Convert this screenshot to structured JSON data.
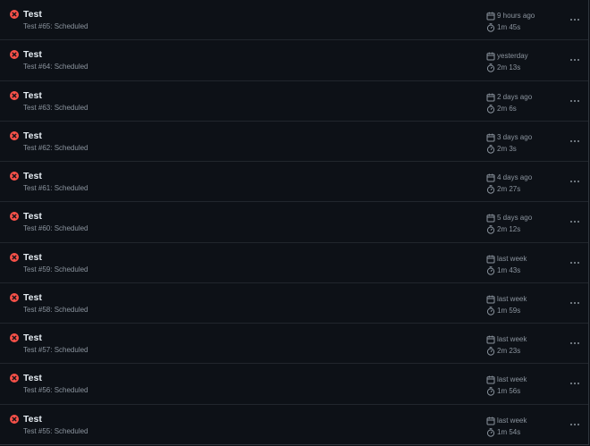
{
  "colors": {
    "background": "#0d1117",
    "failure": "#f85149",
    "text_primary": "#e6edf3",
    "text_muted": "#8b949e",
    "divider": "#21262d"
  },
  "icons": {
    "status": "x-circle-icon",
    "date": "calendar-icon",
    "duration": "stopwatch-icon",
    "menu": "kebab-horizontal-icon"
  },
  "runs": [
    {
      "title": "Test",
      "subtitle": "Test #65: Scheduled",
      "time": "9 hours ago",
      "duration": "1m 45s",
      "status": "failure"
    },
    {
      "title": "Test",
      "subtitle": "Test #64: Scheduled",
      "time": "yesterday",
      "duration": "2m 13s",
      "status": "failure"
    },
    {
      "title": "Test",
      "subtitle": "Test #63: Scheduled",
      "time": "2 days ago",
      "duration": "2m 6s",
      "status": "failure"
    },
    {
      "title": "Test",
      "subtitle": "Test #62: Scheduled",
      "time": "3 days ago",
      "duration": "2m 3s",
      "status": "failure"
    },
    {
      "title": "Test",
      "subtitle": "Test #61: Scheduled",
      "time": "4 days ago",
      "duration": "2m 27s",
      "status": "failure"
    },
    {
      "title": "Test",
      "subtitle": "Test #60: Scheduled",
      "time": "5 days ago",
      "duration": "2m 12s",
      "status": "failure"
    },
    {
      "title": "Test",
      "subtitle": "Test #59: Scheduled",
      "time": "last week",
      "duration": "1m 43s",
      "status": "failure"
    },
    {
      "title": "Test",
      "subtitle": "Test #58: Scheduled",
      "time": "last week",
      "duration": "1m 59s",
      "status": "failure"
    },
    {
      "title": "Test",
      "subtitle": "Test #57: Scheduled",
      "time": "last week",
      "duration": "2m 23s",
      "status": "failure"
    },
    {
      "title": "Test",
      "subtitle": "Test #56: Scheduled",
      "time": "last week",
      "duration": "1m 56s",
      "status": "failure"
    },
    {
      "title": "Test",
      "subtitle": "Test #55: Scheduled",
      "time": "last week",
      "duration": "1m 54s",
      "status": "failure"
    }
  ]
}
